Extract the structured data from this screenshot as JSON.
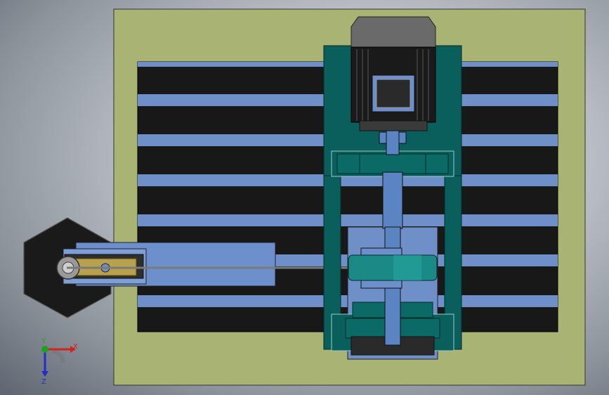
{
  "viewport": {
    "background": "#a9aeb5"
  },
  "colors": {
    "base_plate": "#a8b374",
    "slot_dark": "#181818",
    "slot_light": "#6f8fc9",
    "frame_teal": "#0a5f5c",
    "frame_teal_light": "#1b8a86",
    "shaft_blue": "#5b85c2",
    "motor_dark": "#1a1a1a",
    "motor_cap": "#6a6a6a",
    "cylinder_blue": "#6d8fcb",
    "cylinder_dark": "#2e2e2e",
    "brass": "#b9a04c"
  },
  "triad": {
    "x_label": "X",
    "y_label": "Y",
    "z_label": "Z",
    "x_color": "#d32020",
    "y_color": "#20a020",
    "z_color": "#2030c0"
  }
}
